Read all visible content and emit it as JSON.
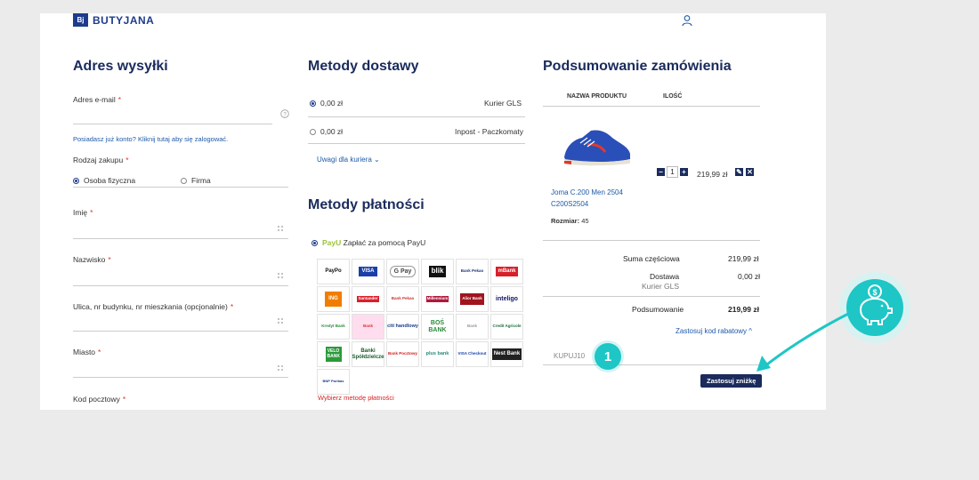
{
  "header": {
    "brand": "BUTYJANA",
    "brand_mark": "Bj",
    "user_icon": "user-icon"
  },
  "shipping": {
    "title": "Adres wysyłki",
    "email_label": "Adres e-mail",
    "login_hint": "Posiadasz już konto? Kliknij tutaj aby się zalogować.",
    "purchase_type_label": "Rodzaj zakupu",
    "purchase_type_options": [
      "Osoba fizyczna",
      "Firma"
    ],
    "purchase_type_selected": "Osoba fizyczna",
    "first_name_label": "Imię",
    "last_name_label": "Nazwisko",
    "street_label": "Ulica, nr budynku, nr mieszkania (opcjonalnie)",
    "city_label": "Miasto",
    "postal_code_label": "Kod pocztowy"
  },
  "delivery": {
    "title": "Metody dostawy",
    "options": [
      {
        "price": "0,00 zł",
        "name": "Kurier GLS",
        "selected": true
      },
      {
        "price": "0,00 zł",
        "name": "Inpost - Paczkomaty",
        "selected": false
      }
    ],
    "courier_notes_label": "Uwagi dla kuriera"
  },
  "payment": {
    "title": "Metody płatności",
    "provider": "PayU",
    "provider_label": "Zapłać za pomocą PayU",
    "methods": [
      "PayPo",
      "VISA",
      "G Pay",
      "blik",
      "Bank Pekao",
      "mBank",
      "ING",
      "Santander",
      "Bank Pekao",
      "Millennium",
      "Alior Bank",
      "inteligo",
      "Kredyt Bank",
      "Bank",
      "citi handlowy",
      "BOŚ BANK",
      "Bank",
      "Credit Agricole",
      "VELO BANK",
      "Banki Spółdzielcze",
      "Bank Pocztowy",
      "plus bank",
      "VISA Checkout",
      "Nest Bank",
      "BNP Paribas"
    ],
    "error": "Wybierz metodę płatności"
  },
  "summary": {
    "title": "Podsumowanie zamówienia",
    "col_product": "NAZWA PRODUKTU",
    "col_qty": "ILOŚĆ",
    "product_name": "Joma C.200 Men 2504 C200S2504",
    "size_label": "Rozmiar:",
    "size_value": "45",
    "quantity": "1",
    "price": "219,99 zł",
    "subtotal_label": "Suma częściowa",
    "subtotal_value": "219,99 zł",
    "delivery_label": "Dostawa",
    "delivery_method": "Kurier GLS",
    "delivery_value": "0,00 zł",
    "total_label": "Podsumowanie",
    "total_value": "219,99 zł",
    "discount_toggle": "Zastosuj kod rabatowy",
    "discount_code": "KUPUJ10",
    "apply_button": "Zastosuj zniżkę"
  },
  "annotation": {
    "step_number": "1",
    "accent_color": "#1ec6c6",
    "icon": "piggy-bank-icon"
  }
}
